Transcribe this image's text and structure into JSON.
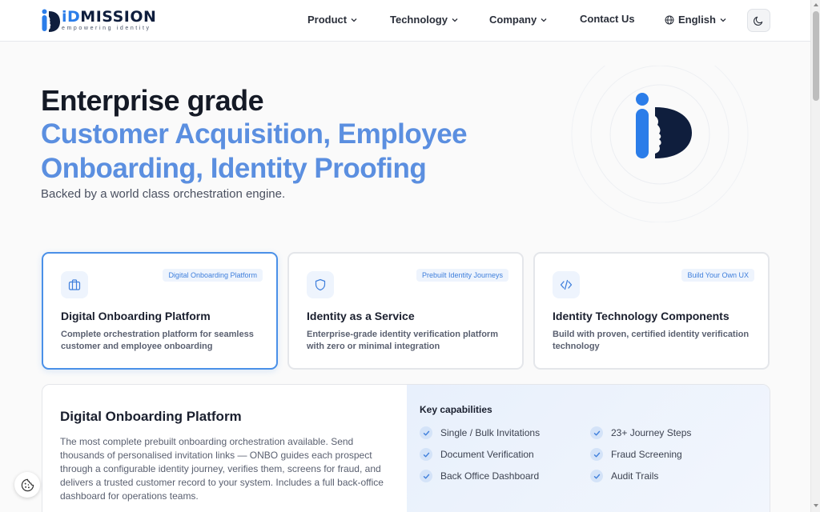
{
  "brand": {
    "logo_word_id": "iD",
    "logo_word_rest": "MISSION",
    "tagline": "empowering identity",
    "accent_color": "#2b7de9",
    "navy_color": "#0f1e3d"
  },
  "nav": {
    "items": [
      {
        "label": "Product",
        "icon": "chevron-down-icon"
      },
      {
        "label": "Technology",
        "icon": "chevron-down-icon"
      },
      {
        "label": "Company",
        "icon": "chevron-down-icon"
      },
      {
        "label": "Contact Us"
      },
      {
        "label": "English",
        "icon": "globe-icon"
      }
    ],
    "theme_toggle_icon": "moon-icon"
  },
  "hero": {
    "title": "Enterprise grade",
    "accent_line_1": "Customer Acquisition, Employee",
    "accent_line_2": "Onboarding, Identity Proofing",
    "subtitle": "Backed by a world class orchestration engine."
  },
  "cards": [
    {
      "badge": "Digital Onboarding Platform",
      "title": "Digital Onboarding Platform",
      "description": "Complete orchestration platform for seamless customer and employee onboarding",
      "icon": "briefcase-icon",
      "active": true
    },
    {
      "badge": "Prebuilt Identity Journeys",
      "title": "Identity as a Service",
      "description": "Enterprise-grade identity verification platform with zero or minimal integration",
      "icon": "shield-icon",
      "active": false
    },
    {
      "badge": "Build Your Own UX",
      "title": "Identity Technology Components",
      "description": "Build with proven, certified identity verification technology",
      "icon": "code-icon",
      "active": false
    }
  ],
  "detail": {
    "title": "Digital Onboarding Platform",
    "body": "The most complete prebuilt onboarding orchestration available. Send thousands of personalised invitation links — ONBO guides each prospect through a configurable identity journey, verifies them, screens for fraud, and delivers a trusted customer record to your system. Includes a full back-office dashboard for operations teams.",
    "capabilities_title": "Key capabilities",
    "capabilities": [
      "Single / Bulk Invitations",
      "23+ Journey Steps",
      "Document Verification",
      "Fraud Screening",
      "Back Office Dashboard",
      "Audit Trails"
    ]
  },
  "cookie_icon": "cookie-icon"
}
